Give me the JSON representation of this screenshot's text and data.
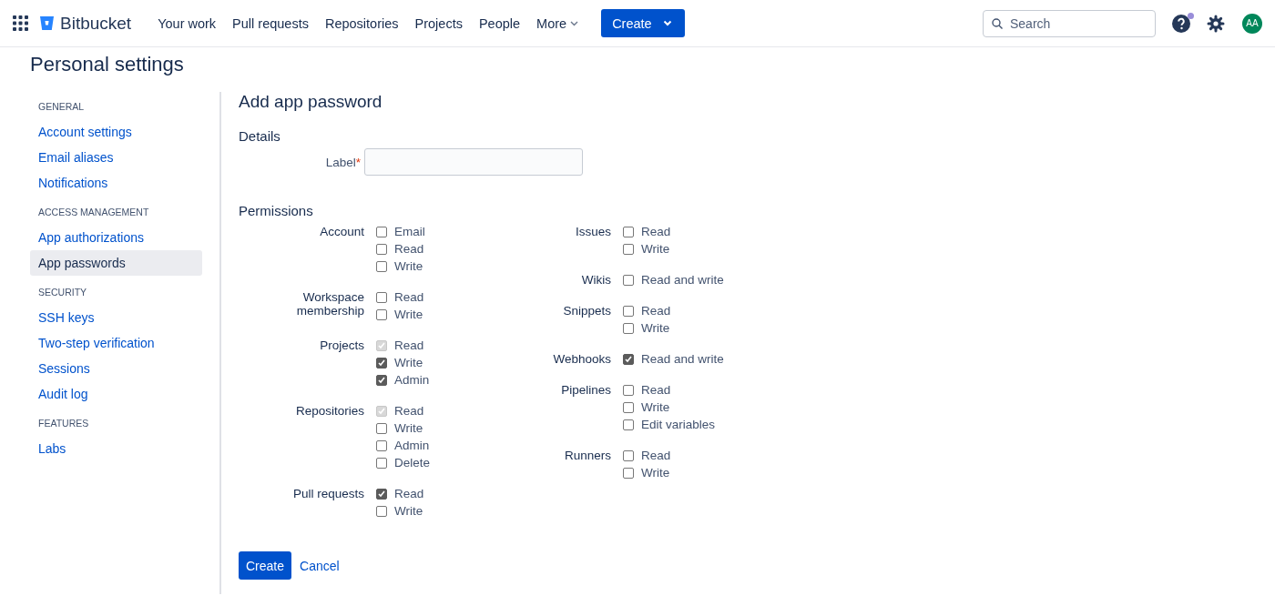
{
  "header": {
    "logo": "Bitbucket",
    "nav": [
      {
        "label": "Your work",
        "dropdown": false
      },
      {
        "label": "Pull requests",
        "dropdown": false
      },
      {
        "label": "Repositories",
        "dropdown": false
      },
      {
        "label": "Projects",
        "dropdown": false
      },
      {
        "label": "People",
        "dropdown": false
      },
      {
        "label": "More",
        "dropdown": true
      }
    ],
    "create_button": "Create",
    "search": {
      "placeholder": "Search"
    },
    "help_notification": true,
    "avatar": "AA"
  },
  "page_title": "Personal settings",
  "sidebar": {
    "sections": [
      {
        "heading": "GENERAL",
        "items": [
          {
            "label": "Account settings",
            "selected": false
          },
          {
            "label": "Email aliases",
            "selected": false
          },
          {
            "label": "Notifications",
            "selected": false
          }
        ]
      },
      {
        "heading": "ACCESS MANAGEMENT",
        "items": [
          {
            "label": "App authorizations",
            "selected": false
          },
          {
            "label": "App passwords",
            "selected": true
          }
        ]
      },
      {
        "heading": "SECURITY",
        "items": [
          {
            "label": "SSH keys",
            "selected": false
          },
          {
            "label": "Two-step verification",
            "selected": false
          },
          {
            "label": "Sessions",
            "selected": false
          },
          {
            "label": "Audit log",
            "selected": false
          }
        ]
      },
      {
        "heading": "FEATURES",
        "items": [
          {
            "label": "Labs",
            "selected": false
          }
        ]
      }
    ]
  },
  "form": {
    "title": "Add app password",
    "details_heading": "Details",
    "label_field": {
      "label": "Label",
      "required_mark": "*"
    },
    "permissions_heading": "Permissions",
    "columns": [
      [
        {
          "group": "Account",
          "options": [
            {
              "label": "Email",
              "checked": false,
              "disabled": false
            },
            {
              "label": "Read",
              "checked": false,
              "disabled": false
            },
            {
              "label": "Write",
              "checked": false,
              "disabled": false
            }
          ]
        },
        {
          "group": "Workspace membership",
          "options": [
            {
              "label": "Read",
              "checked": false,
              "disabled": false
            },
            {
              "label": "Write",
              "checked": false,
              "disabled": false
            }
          ]
        },
        {
          "group": "Projects",
          "options": [
            {
              "label": "Read",
              "checked": true,
              "disabled": true
            },
            {
              "label": "Write",
              "checked": true,
              "disabled": false
            },
            {
              "label": "Admin",
              "checked": true,
              "disabled": false
            }
          ]
        },
        {
          "group": "Repositories",
          "options": [
            {
              "label": "Read",
              "checked": true,
              "disabled": true
            },
            {
              "label": "Write",
              "checked": false,
              "disabled": false
            },
            {
              "label": "Admin",
              "checked": false,
              "disabled": false
            },
            {
              "label": "Delete",
              "checked": false,
              "disabled": false
            }
          ]
        },
        {
          "group": "Pull requests",
          "options": [
            {
              "label": "Read",
              "checked": true,
              "disabled": false
            },
            {
              "label": "Write",
              "checked": false,
              "disabled": false
            }
          ]
        }
      ],
      [
        {
          "group": "Issues",
          "options": [
            {
              "label": "Read",
              "checked": false,
              "disabled": false
            },
            {
              "label": "Write",
              "checked": false,
              "disabled": false
            }
          ]
        },
        {
          "group": "Wikis",
          "options": [
            {
              "label": "Read and write",
              "checked": false,
              "disabled": false
            }
          ]
        },
        {
          "group": "Snippets",
          "options": [
            {
              "label": "Read",
              "checked": false,
              "disabled": false
            },
            {
              "label": "Write",
              "checked": false,
              "disabled": false
            }
          ]
        },
        {
          "group": "Webhooks",
          "options": [
            {
              "label": "Read and write",
              "checked": true,
              "disabled": false
            }
          ]
        },
        {
          "group": "Pipelines",
          "options": [
            {
              "label": "Read",
              "checked": false,
              "disabled": false
            },
            {
              "label": "Write",
              "checked": false,
              "disabled": false
            },
            {
              "label": "Edit variables",
              "checked": false,
              "disabled": false
            }
          ]
        },
        {
          "group": "Runners",
          "options": [
            {
              "label": "Read",
              "checked": false,
              "disabled": false
            },
            {
              "label": "Write",
              "checked": false,
              "disabled": false
            }
          ]
        }
      ]
    ],
    "submit": "Create",
    "cancel": "Cancel"
  }
}
